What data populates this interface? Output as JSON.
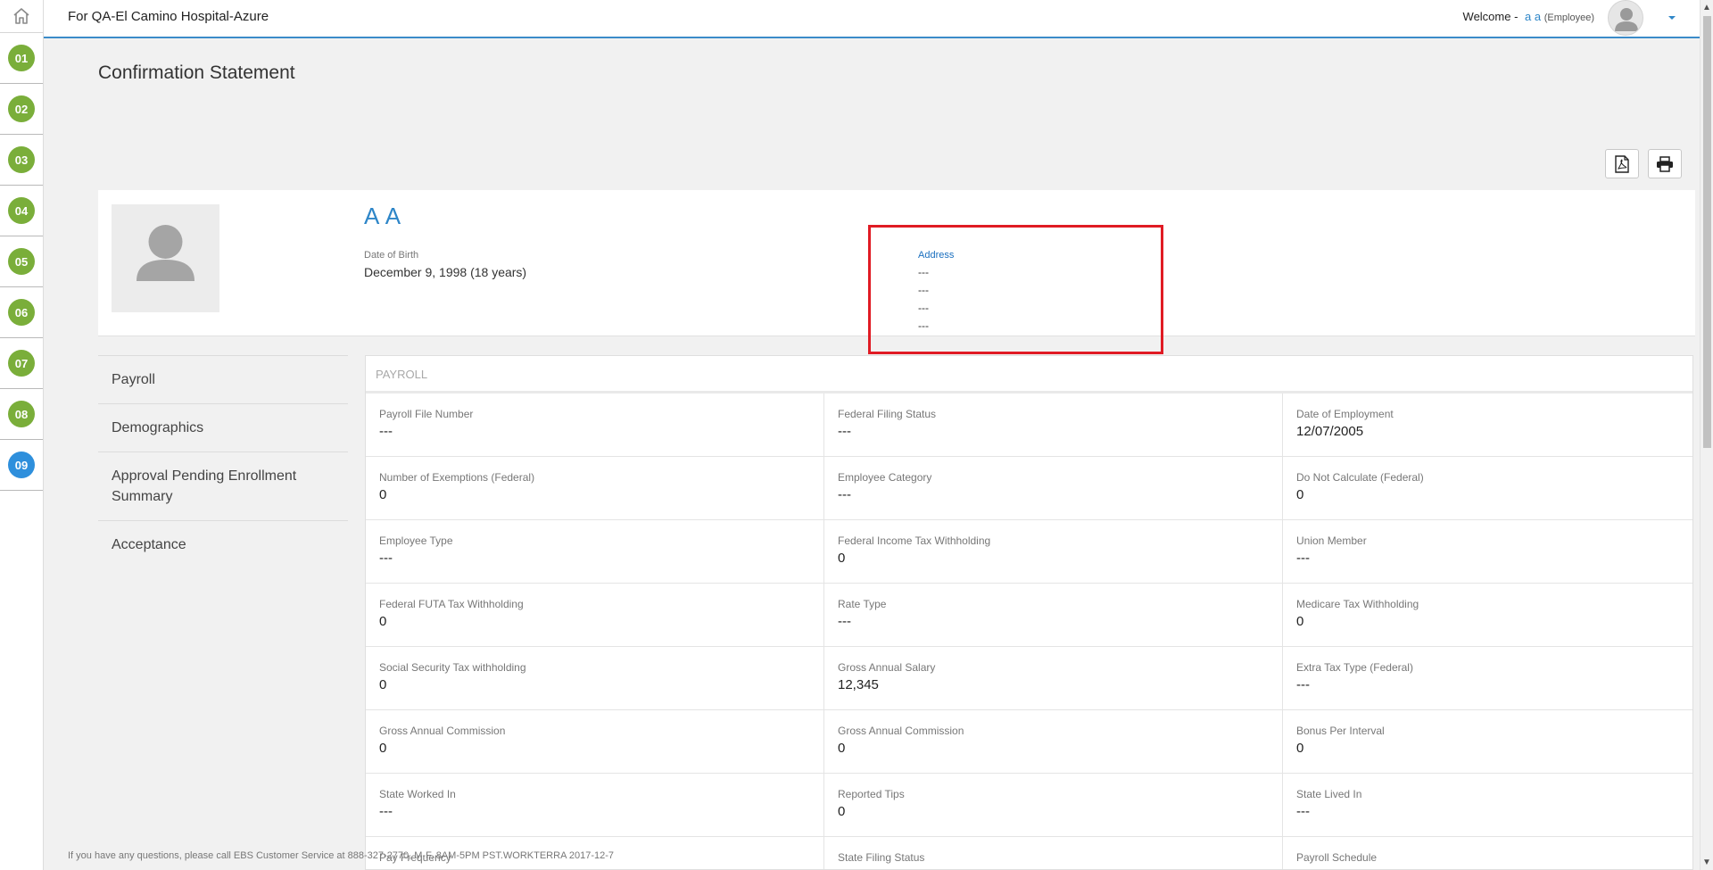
{
  "header": {
    "org_title": "For QA-El Camino Hospital-Azure",
    "welcome_prefix": "Welcome -",
    "user_name": "a a",
    "user_role": "(Employee)"
  },
  "rail": {
    "steps": [
      "01",
      "02",
      "03",
      "04",
      "05",
      "06",
      "07",
      "08",
      "09"
    ],
    "active_step": "09"
  },
  "page": {
    "title": "Confirmation Statement"
  },
  "toolbar": {
    "pdf_icon": "pdf-icon",
    "print_icon": "print-icon"
  },
  "profile": {
    "name": "A A",
    "dob_label": "Date of Birth",
    "dob_value": "December 9, 1998 (18 years)",
    "address_label": "Address",
    "address_lines": [
      "---",
      "---",
      "---",
      "---"
    ]
  },
  "nav": {
    "items": [
      "Payroll",
      "Demographics",
      "Approval Pending Enrollment Summary",
      "Acceptance"
    ]
  },
  "payroll": {
    "heading": "PAYROLL",
    "fields": [
      {
        "label": "Payroll File Number",
        "value": "---"
      },
      {
        "label": "Federal Filing Status",
        "value": "---"
      },
      {
        "label": "Date of Employment",
        "value": "12/07/2005"
      },
      {
        "label": "Number of Exemptions (Federal)",
        "value": "0"
      },
      {
        "label": "Employee Category",
        "value": "---"
      },
      {
        "label": "Do Not Calculate (Federal)",
        "value": "0"
      },
      {
        "label": "Employee Type",
        "value": "---"
      },
      {
        "label": "Federal Income Tax Withholding",
        "value": "0"
      },
      {
        "label": "Union Member",
        "value": "---"
      },
      {
        "label": "Federal FUTA Tax Withholding",
        "value": "0"
      },
      {
        "label": "Rate Type",
        "value": "---"
      },
      {
        "label": "Medicare Tax Withholding",
        "value": "0"
      },
      {
        "label": "Social Security Tax withholding",
        "value": "0"
      },
      {
        "label": "Gross Annual Salary",
        "value": "12,345"
      },
      {
        "label": "Extra Tax Type (Federal)",
        "value": "---"
      },
      {
        "label": "Gross Annual Commission",
        "value": "0"
      },
      {
        "label": "Gross Annual Commission",
        "value": "0"
      },
      {
        "label": "Bonus Per Interval",
        "value": "0"
      },
      {
        "label": "State Worked In",
        "value": "---"
      },
      {
        "label": "Reported Tips",
        "value": "0"
      },
      {
        "label": "State Lived In",
        "value": "---"
      },
      {
        "label": "Pay Frequency",
        "value": ""
      },
      {
        "label": "State Filing Status",
        "value": ""
      },
      {
        "label": "Payroll Schedule",
        "value": ""
      }
    ]
  },
  "footer": {
    "note": "If you have any questions, please call EBS Customer Service at 888-327-2770, M-F, 8AM-5PM PST.WORKTERRA 2017-12-7"
  },
  "colors": {
    "step_green": "#7aae3a",
    "step_active_blue": "#2e8fdc",
    "link_blue": "#2e86c8",
    "highlight_red": "#e01b24"
  }
}
